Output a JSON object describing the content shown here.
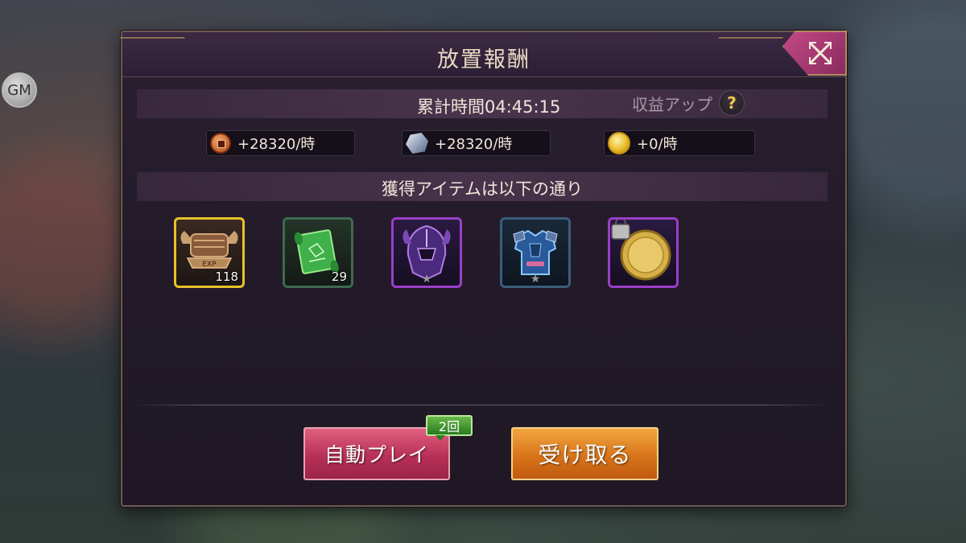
{
  "gm_badge": "GM",
  "dialog": {
    "title": "放置報酬",
    "cumulative_time": "累計時間04:45:15",
    "bonus_label": "収益アップ",
    "help_symbol": "?",
    "rates": [
      {
        "icon": "copper-coin-icon",
        "value": "+28320/時"
      },
      {
        "icon": "ore-icon",
        "value": "+28320/時"
      },
      {
        "icon": "gold-coin-icon",
        "value": "+0/時"
      }
    ],
    "items_header": "獲得アイテムは以下の通り",
    "items": [
      {
        "icon": "exp-chest-icon",
        "quantity": "118",
        "rarity_color": "#e6c22a"
      },
      {
        "icon": "scroll-icon",
        "quantity": "29",
        "rarity_color": "#3e6a4e"
      },
      {
        "icon": "helmet-icon",
        "stars": 1,
        "rarity_color": "#9b3ec8"
      },
      {
        "icon": "armor-icon",
        "stars": 1,
        "rarity_color": "#3a5e7a"
      },
      {
        "icon": "locked-gold-medal-icon",
        "rarity_color": "#9b3ec8"
      }
    ],
    "auto_play_button": "自動プレイ",
    "auto_play_count": "2回",
    "receive_button": "受け取る"
  }
}
